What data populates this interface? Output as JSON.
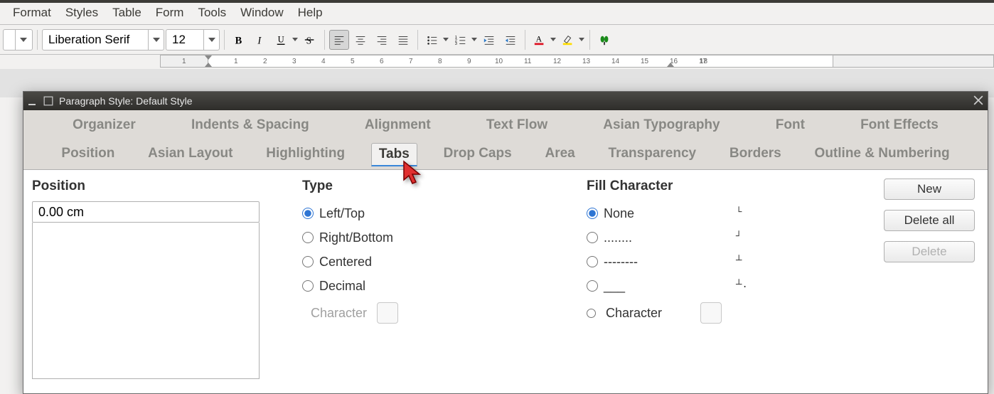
{
  "menubar": {
    "items": [
      "Format",
      "Styles",
      "Table",
      "Form",
      "Tools",
      "Window",
      "Help"
    ]
  },
  "toolbar": {
    "styleDropdown": "",
    "fontName": "Liberation Serif",
    "fontSize": "12"
  },
  "ruler": {
    "numbers": [
      "1",
      "1",
      "2",
      "3",
      "4",
      "5",
      "6",
      "7",
      "8",
      "9",
      "10",
      "11",
      "12",
      "13",
      "14",
      "15",
      "16",
      "17",
      "18"
    ]
  },
  "dialog": {
    "title": "Paragraph Style: Default Style",
    "tabsRow1": [
      "Organizer",
      "Indents & Spacing",
      "Alignment",
      "Text Flow",
      "Asian Typography",
      "Font",
      "Font Effects"
    ],
    "tabsRow2": [
      "Position",
      "Asian Layout",
      "Highlighting",
      "Tabs",
      "Drop Caps",
      "Area",
      "Transparency",
      "Borders",
      "Outline & Numbering"
    ],
    "activeTab": "Tabs",
    "position": {
      "heading": "Position",
      "value": "0.00 cm"
    },
    "type": {
      "heading": "Type",
      "options": [
        {
          "label": "Left/Top",
          "glyph": "⌞",
          "checked": true
        },
        {
          "label": "Right/Bottom",
          "glyph": "⌟",
          "checked": false
        },
        {
          "label": "Centered",
          "glyph": "⊥",
          "checked": false
        },
        {
          "label": "Decimal",
          "glyph": "⊥.",
          "checked": false
        }
      ],
      "characterLabel": "Character",
      "characterEnabled": false
    },
    "fill": {
      "heading": "Fill Character",
      "options": [
        {
          "label": "None",
          "checked": true
        },
        {
          "label": "........",
          "checked": false
        },
        {
          "label": "--------",
          "checked": false
        },
        {
          "label": "___",
          "checked": false
        }
      ],
      "characterLabel": "Character",
      "characterEnabled": true
    },
    "buttons": {
      "new": "New",
      "deleteAll": "Delete all",
      "delete": "Delete"
    }
  }
}
